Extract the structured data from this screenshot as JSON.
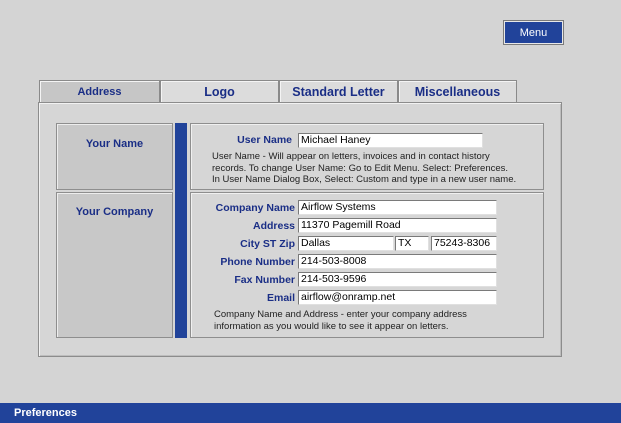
{
  "menu_button": {
    "label": "Menu"
  },
  "tabs": [
    {
      "label": "Address",
      "active": true
    },
    {
      "label": "Logo",
      "active": false
    },
    {
      "label": "Standard Letter",
      "active": false
    },
    {
      "label": "Miscellaneous",
      "active": false
    }
  ],
  "your_name": {
    "section_label": "Your Name",
    "user_name_label": "User Name",
    "user_name_value": "Michael Haney",
    "help_lines": [
      "User Name - Will appear on letters, invoices and in contact history",
      "records. To change User Name: Go to Edit Menu. Select: Preferences.",
      "In User Name Dialog Box, Select: Custom and type in a new user name."
    ]
  },
  "your_company": {
    "section_label": "Your Company",
    "company_name_label": "Company Name",
    "company_name_value": "Airflow Systems",
    "address_label": "Address",
    "address_value": "11370 Pagemill Road",
    "city_st_zip_label": "City ST Zip",
    "city_value": "Dallas",
    "state_value": "TX",
    "zip_value": "75243-8306",
    "phone_label": "Phone Number",
    "phone_value": "214-503-8008",
    "fax_label": "Fax Number",
    "fax_value": "214-503-9596",
    "email_label": "Email",
    "email_value": "airflow@onramp.net",
    "help_lines": [
      "Company Name and Address - enter your company address",
      "information as you would like to see it appear on letters."
    ]
  },
  "status_bar": {
    "title": "Preferences"
  },
  "colors": {
    "accent": "#21439a",
    "label_text": "#1a2e86",
    "background": "#d4d4d4"
  }
}
